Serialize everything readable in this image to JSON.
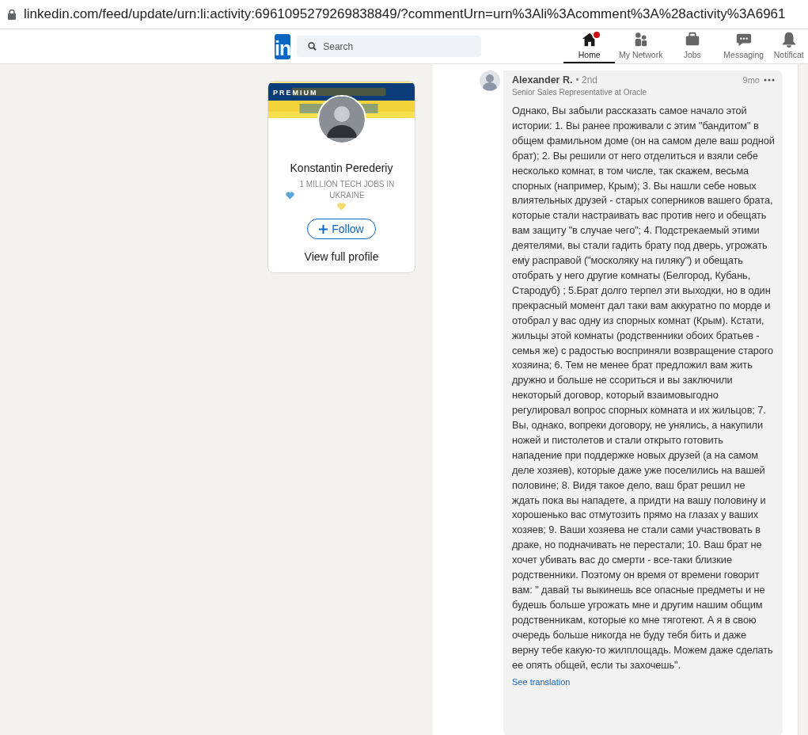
{
  "address_bar": {
    "url": "linkedin.com/feed/update/urn:li:activity:6961095279269838849/?commentUrn=urn%3Ali%3Acomment%3A%28activity%3A6961"
  },
  "nav": {
    "logo": "in",
    "search": {
      "placeholder": "Search"
    },
    "items": [
      {
        "label": "Home",
        "kind": "home",
        "selected": true,
        "badge": true
      },
      {
        "label": "My Network",
        "kind": "network",
        "selected": false,
        "badge": false
      },
      {
        "label": "Jobs",
        "kind": "jobs",
        "selected": false,
        "badge": false
      },
      {
        "label": "Messaging",
        "kind": "messaging",
        "selected": false,
        "badge": false
      },
      {
        "label": "Notificat",
        "kind": "bell",
        "selected": false,
        "badge": false
      }
    ]
  },
  "profile_card": {
    "badge": "PREMIUM",
    "name": "Konstantin Perederiy",
    "headline": "1 MILLION TECH JOBS IN UKRAINE",
    "follow": "Follow",
    "view_profile": "View full profile"
  },
  "comment": {
    "author": "Alexander R.",
    "degree": "• 2nd",
    "time": "9mo",
    "title": "Senior Sales Representative at Oracle",
    "text": "Однако, Вы забыли рассказать самое начало этой истории: 1. Вы ранее проживали с этим \"бандитом\" в общем фамильном доме (он на самом деле ваш родной брат); 2. Вы решили от него отделиться и взяли себе несколько комнат, в том числе, так скажем, весьма спорных (например, Крым); 3. Вы нашли себе новых влиятельных друзей - старых соперников вашего брата, которые стали настраивать вас против него и обещать вам защиту \"в случае чего\"; 4. Подстрекаемый этими деятелями, вы стали гадить брату под дверь, угрожать ему расправой (\"москоляку на гиляку\") и обещать отобрать у него другие комнаты (Белгород, Кубань, Стародуб) ; 5.Брат долго терпел эти выходки, но в один прекрасный момент дал таки вам аккуратно по морде и отобрал у вас одну из спорных комнат (Крым). Кстати, жильцы этой комнаты (родственники обоих братьев - семья же) с радостью восприняли возвращение старого хозяина; 6. Тем не менее брат предложил вам жить дружно и больше не ссориться и вы заключили некоторый договор, который взаимовыгодно регулировал вопрос  спорных комната и их жильцов; 7. Вы, однако, вопреки договору, не унялись, а накупили ножей и пистолетов и стали открыто готовить нападение при поддержке новых друзей (а на самом деле хозяев), которые даже уже поселились на вашей половине; 8. Видя такое дело, ваш брат решил не ждать пока вы нападете, а придти на вашу половину и хорошенько вас отмутозить прямо на глазах у ваших хозяев; 9. Ваши хозяева не стали сами участвовать в драке, но подначивать не перестали; 10. Ваш брат не хочет убивать вас до смерти - все-таки близкие родственники. Поэтому он время от времени говорит вам: \" давай ты выкинешь все опасные предметы и  не будешь больше угрожать мне и другим нашим общим родственникам, которые ко мне тяготеют. А я в свою очередь больше никогда не буду тебя бить и даже верну тебе какую-то жилплощадь. Можем даже сделать ее опять общей, если ты захочешь\".",
    "translate": "See translation"
  }
}
